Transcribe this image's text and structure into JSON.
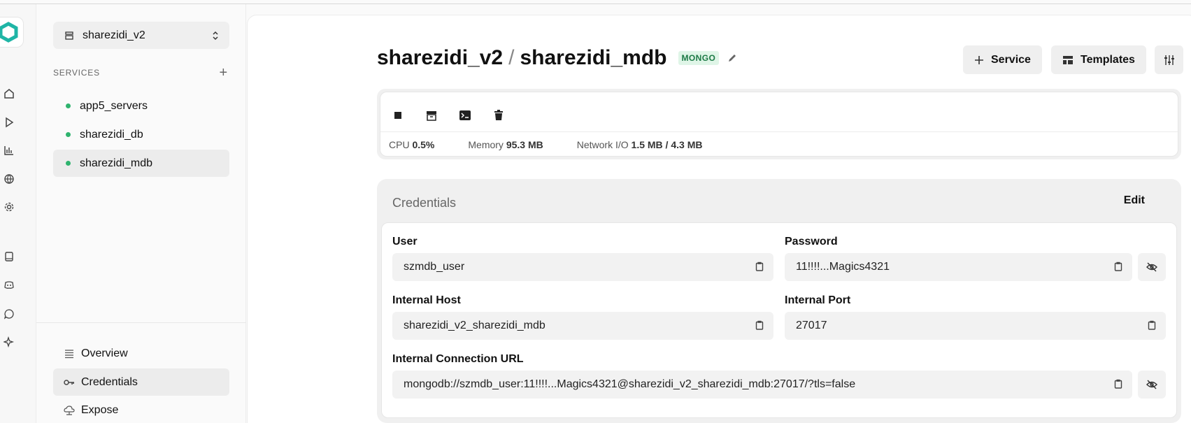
{
  "sidebar": {
    "project": "sharezidi_v2",
    "services_heading": "SERVICES",
    "services": [
      {
        "name": "app5_servers",
        "status_color": "#2fb36e"
      },
      {
        "name": "sharezidi_db",
        "status_color": "#2fb36e"
      },
      {
        "name": "sharezidi_mdb",
        "status_color": "#2fb36e",
        "active": true
      }
    ],
    "nav": [
      {
        "label": "Overview",
        "icon": "list-icon"
      },
      {
        "label": "Credentials",
        "icon": "key-icon",
        "active": true
      },
      {
        "label": "Expose",
        "icon": "expose-icon"
      }
    ]
  },
  "rail": {
    "icons": [
      "home-icon",
      "play-icon",
      "chart-icon",
      "globe-icon",
      "gear-icon",
      "book-icon",
      "discord-icon",
      "chat-icon",
      "sparkle-icon"
    ]
  },
  "header": {
    "project": "sharezidi_v2",
    "separator": "/",
    "service": "sharezidi_mdb",
    "badge": "MONGO",
    "service_button": "Service",
    "templates_button": "Templates"
  },
  "status": {
    "cpu_label": "CPU",
    "cpu_value": "0.5%",
    "memory_label": "Memory",
    "memory_value": "95.3 MB",
    "network_label": "Network I/O",
    "network_value": "1.5 MB / 4.3 MB"
  },
  "credentials": {
    "title": "Credentials",
    "edit_label": "Edit",
    "user_label": "User",
    "user_value": "szmdb_user",
    "password_label": "Password",
    "password_value": "11!!!!...Magics4321",
    "host_label": "Internal Host",
    "host_value": "sharezidi_v2_sharezidi_mdb",
    "port_label": "Internal Port",
    "port_value": "27017",
    "url_label": "Internal Connection URL",
    "url_value": "mongodb://szmdb_user:11!!!!...Magics4321@sharezidi_v2_sharezidi_mdb:27017/?tls=false"
  },
  "colors": {
    "accent_teal": "#1fb5a6",
    "badge_bg": "#dff5e7",
    "badge_text": "#1d7a46",
    "status_green": "#2fb36e"
  }
}
